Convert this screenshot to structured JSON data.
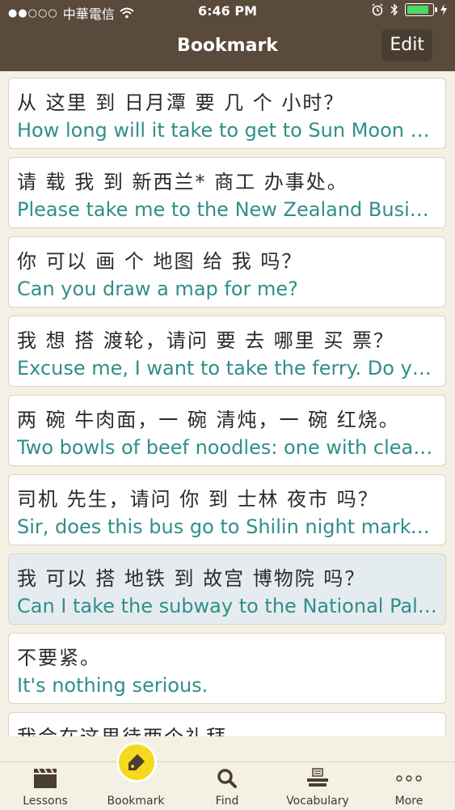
{
  "status": {
    "carrier": "中華電信",
    "time": "6:46 PM"
  },
  "header": {
    "title": "Bookmark",
    "edit_label": "Edit"
  },
  "items": [
    {
      "zh": "从 这里 到 日月潭 要 几 个 小时？",
      "en": "How long will it take to get to Sun Moon Lake?"
    },
    {
      "zh": "请 载 我 到 新西兰* 商工 办事处。",
      "en": "Please take me to the New Zealand Business and Commerce Office."
    },
    {
      "zh": "你 可以 画 个 地图 给 我 吗？",
      "en": "Can you draw a map for me?"
    },
    {
      "zh": "我 想 搭 渡轮，请问 要 去 哪里 买 票？",
      "en": "Excuse me, I want to take the ferry. Do you know where I can buy a ticket?"
    },
    {
      "zh": "两 碗 牛肉面，一 碗 清炖，一 碗 红烧。",
      "en": "Two bowls of beef noodles: one with clear broth, one braised."
    },
    {
      "zh": "司机 先生，请问 你 到 士林 夜市 吗？",
      "en": "Sir, does this bus go to Shilin night market?"
    },
    {
      "zh": "我 可以 搭 地铁 到 故宫 博物院 吗？",
      "en": "Can I take the subway to the National Palace Museum?"
    },
    {
      "zh": "不要紧。",
      "en": "It's nothing serious."
    },
    {
      "zh": "我会在这里待两个礼拜。",
      "en": ""
    }
  ],
  "tabs": {
    "lessons": "Lessons",
    "bookmark": "Bookmark",
    "find": "Find",
    "vocabulary": "Vocabulary",
    "more": "More"
  },
  "colors": {
    "header_bg": "#5a4a3c",
    "english_text": "#2f8f88",
    "selected_bg": "#e5ecef",
    "bookmark_accent": "#f6d81c"
  }
}
